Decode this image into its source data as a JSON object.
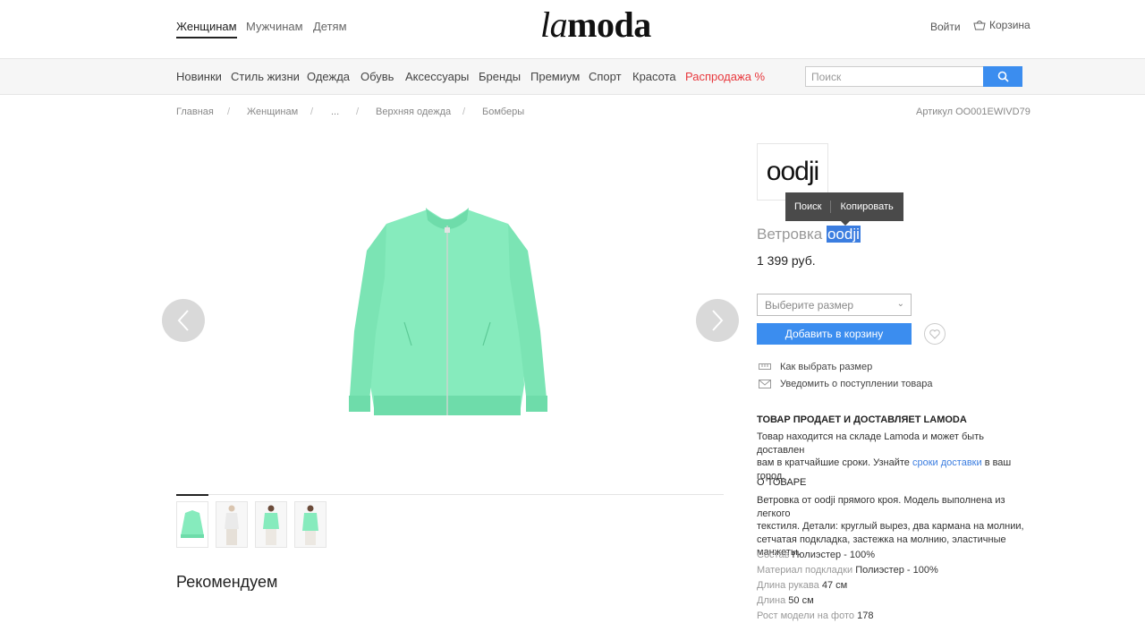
{
  "header": {
    "genders": [
      "Женщинам",
      "Мужчинам",
      "Детям"
    ],
    "logo_italic": "la",
    "logo_rest": "moda",
    "login": "Войти",
    "cart": "Корзина"
  },
  "nav": {
    "items": [
      "Новинки",
      "Стиль жизни",
      "Одежда",
      "Обувь",
      "Аксессуары",
      "Бренды",
      "Премиум",
      "Спорт",
      "Красота"
    ],
    "sale": "Распродажа %",
    "search_placeholder": "Поиск"
  },
  "breadcrumbs": [
    "Главная",
    "Женщинам",
    "...",
    "Верхняя одежда",
    "Бомберы"
  ],
  "article": "Артикул OO001EWIVD79",
  "brand": "oodji",
  "context_menu": {
    "search": "Поиск",
    "copy": "Копировать"
  },
  "product": {
    "title_prefix": "Ветровка",
    "title_selected": "oodji",
    "price": "1 399 руб.",
    "size_placeholder": "Выберите размер",
    "add_to_cart": "Добавить в корзину",
    "size_help": "Как выбрать размер",
    "notify": "Уведомить о поступлении товара",
    "color": "#7ee8b8"
  },
  "delivery": {
    "heading": "ТОВАР ПРОДАЕТ И ДОСТАВЛЯЕТ LAMODA",
    "text_1": "Товар находится на складе Lamoda и может быть доставлен",
    "text_2a": "вам в кратчайшие сроки. Узнайте",
    "text_link": "сроки доставки",
    "text_2b": "в ваш город."
  },
  "about": {
    "heading": "О ТОВАРЕ",
    "lines": [
      "Ветровка от oodji прямого кроя. Модель выполнена из легкого",
      "текстиля. Детали: круглый вырез, два кармана на молнии,",
      "сетчатая подкладка, застежка на молнию, эластичные",
      "манжеты."
    ],
    "attributes": [
      {
        "k": "Состав",
        "v": "Полиэстер - 100%"
      },
      {
        "k": "Материал подкладки",
        "v": "Полиэстер - 100%"
      },
      {
        "k": "Длина рукава",
        "v": "47 см"
      },
      {
        "k": "Длина",
        "v": "50 см"
      },
      {
        "k": "Рост модели на фото",
        "v": "178"
      }
    ]
  },
  "recommend": "Рекомендуем"
}
